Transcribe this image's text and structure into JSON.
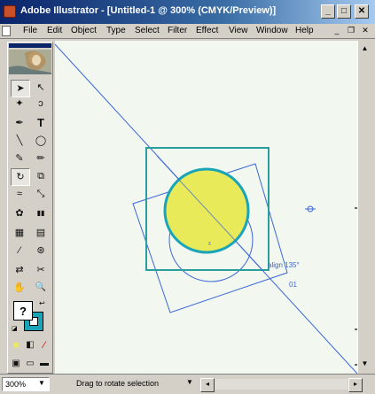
{
  "window": {
    "title": "Adobe Illustrator - [Untitled-1 @ 300% (CMYK/Preview)]",
    "min_glyph": "_",
    "max_glyph": "□",
    "close_glyph": "✕"
  },
  "menu": [
    "File",
    "Edit",
    "Object",
    "Type",
    "Select",
    "Filter",
    "Effect",
    "View",
    "Window",
    "Help"
  ],
  "mdi": {
    "min": "_",
    "restore": "❐",
    "close": "✕"
  },
  "tools": {
    "selection": "➤",
    "direct_selection": "↖",
    "magic_wand": "✦",
    "lasso": "ↄ",
    "pen": "✒",
    "type": "T",
    "line": "╲",
    "ellipse": "◯",
    "paintbrush": "✎",
    "pencil": "✏",
    "rotate": "↻",
    "scale": "⧉",
    "warp": "≈",
    "free_transform": "⤡",
    "symbol_sprayer": "✿",
    "graph": "▮▮",
    "mesh": "▦",
    "gradient": "▤",
    "eyedropper": "⁄",
    "paint_bucket": "⊛",
    "blend": "⇄",
    "scissors": "✂",
    "hand": "✋",
    "zoom": "🔍",
    "fill_stroke": "?",
    "color": "■",
    "gradient_mode": "◧",
    "none": "⁄",
    "screen_modes": [
      "▣",
      "▭",
      "▬"
    ]
  },
  "canvas": {
    "smart_guide_label": "align 135°",
    "angle_label": "01",
    "circle_fill": "#e8ea5a",
    "circle_stroke": "#1aa4b8",
    "frame_stroke": "#2a9d9d",
    "guide_color": "#3a66d8"
  },
  "status": {
    "zoom": "300%",
    "message": "Drag to rotate selection"
  }
}
